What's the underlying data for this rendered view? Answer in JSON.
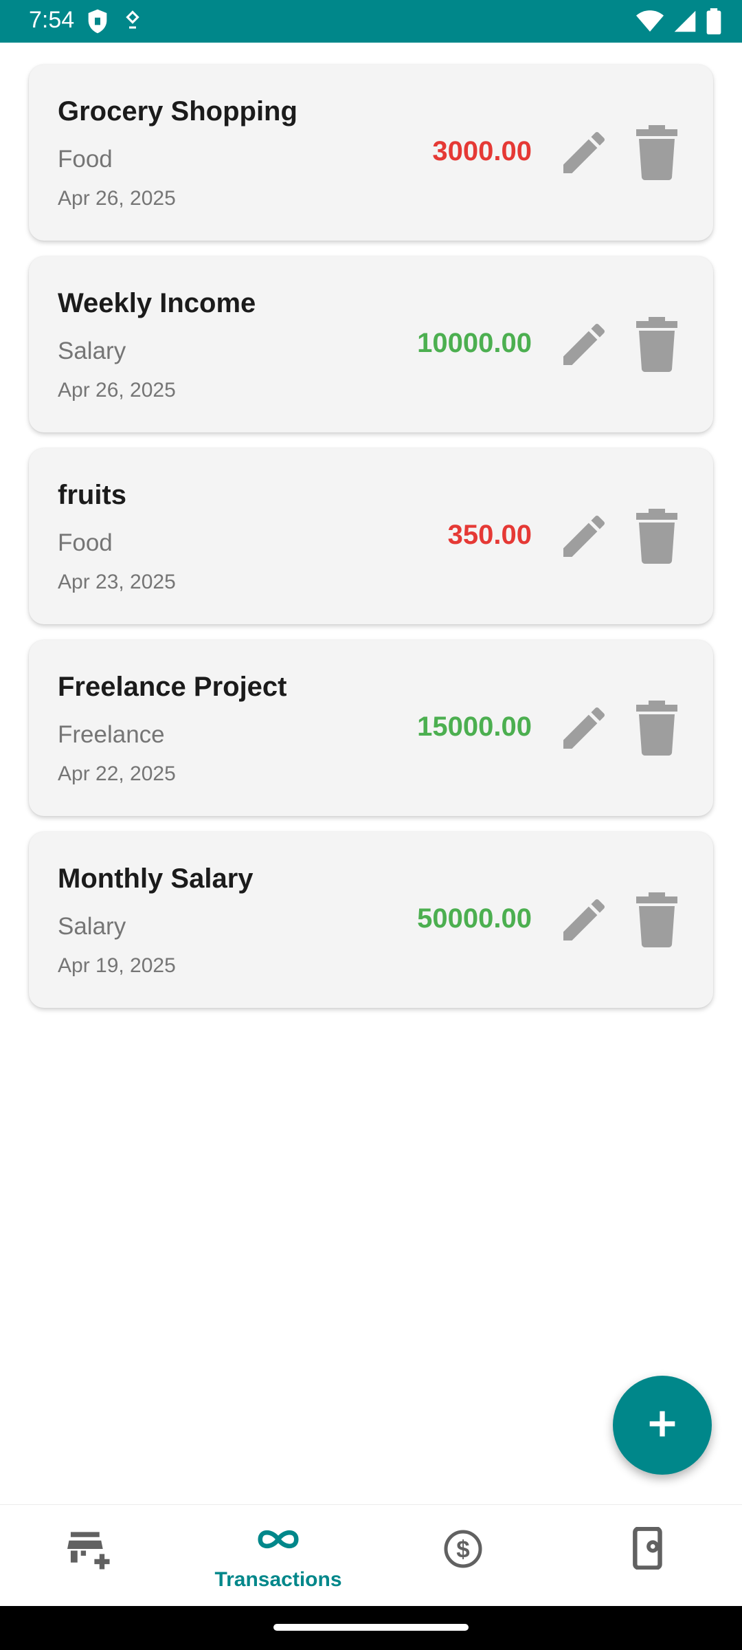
{
  "status_bar": {
    "time": "7:54",
    "left_icons": [
      "shield-icon",
      "location-icon"
    ],
    "right_icons": [
      "wifi-icon",
      "signal-icon",
      "battery-icon"
    ],
    "background": "#00878a"
  },
  "transactions": [
    {
      "title": "Grocery Shopping",
      "category": "Food",
      "date": "Apr 26, 2025",
      "amount": "3000.00",
      "type": "expense"
    },
    {
      "title": "Weekly Income",
      "category": "Salary",
      "date": "Apr 26, 2025",
      "amount": "10000.00",
      "type": "income"
    },
    {
      "title": "fruits",
      "category": "Food",
      "date": "Apr 23, 2025",
      "amount": "350.00",
      "type": "expense"
    },
    {
      "title": "Freelance Project",
      "category": "Freelance",
      "date": "Apr 22, 2025",
      "amount": "15000.00",
      "type": "income"
    },
    {
      "title": "Monthly Salary",
      "category": "Salary",
      "date": "Apr 19, 2025",
      "amount": "50000.00",
      "type": "income"
    }
  ],
  "colors": {
    "expense": "#e53935",
    "income": "#4caf50",
    "accent": "#00878a",
    "action_icon": "#9e9e9e",
    "nav_inactive": "#616161"
  },
  "fab": {
    "icon": "plus-icon"
  },
  "bottom_nav": {
    "items": [
      {
        "icon": "store-add-icon",
        "label": "",
        "active": false
      },
      {
        "icon": "infinity-icon",
        "label": "Transactions",
        "active": true
      },
      {
        "icon": "dollar-circle-icon",
        "label": "",
        "active": false
      },
      {
        "icon": "phone-settings-icon",
        "label": "",
        "active": false
      }
    ]
  }
}
